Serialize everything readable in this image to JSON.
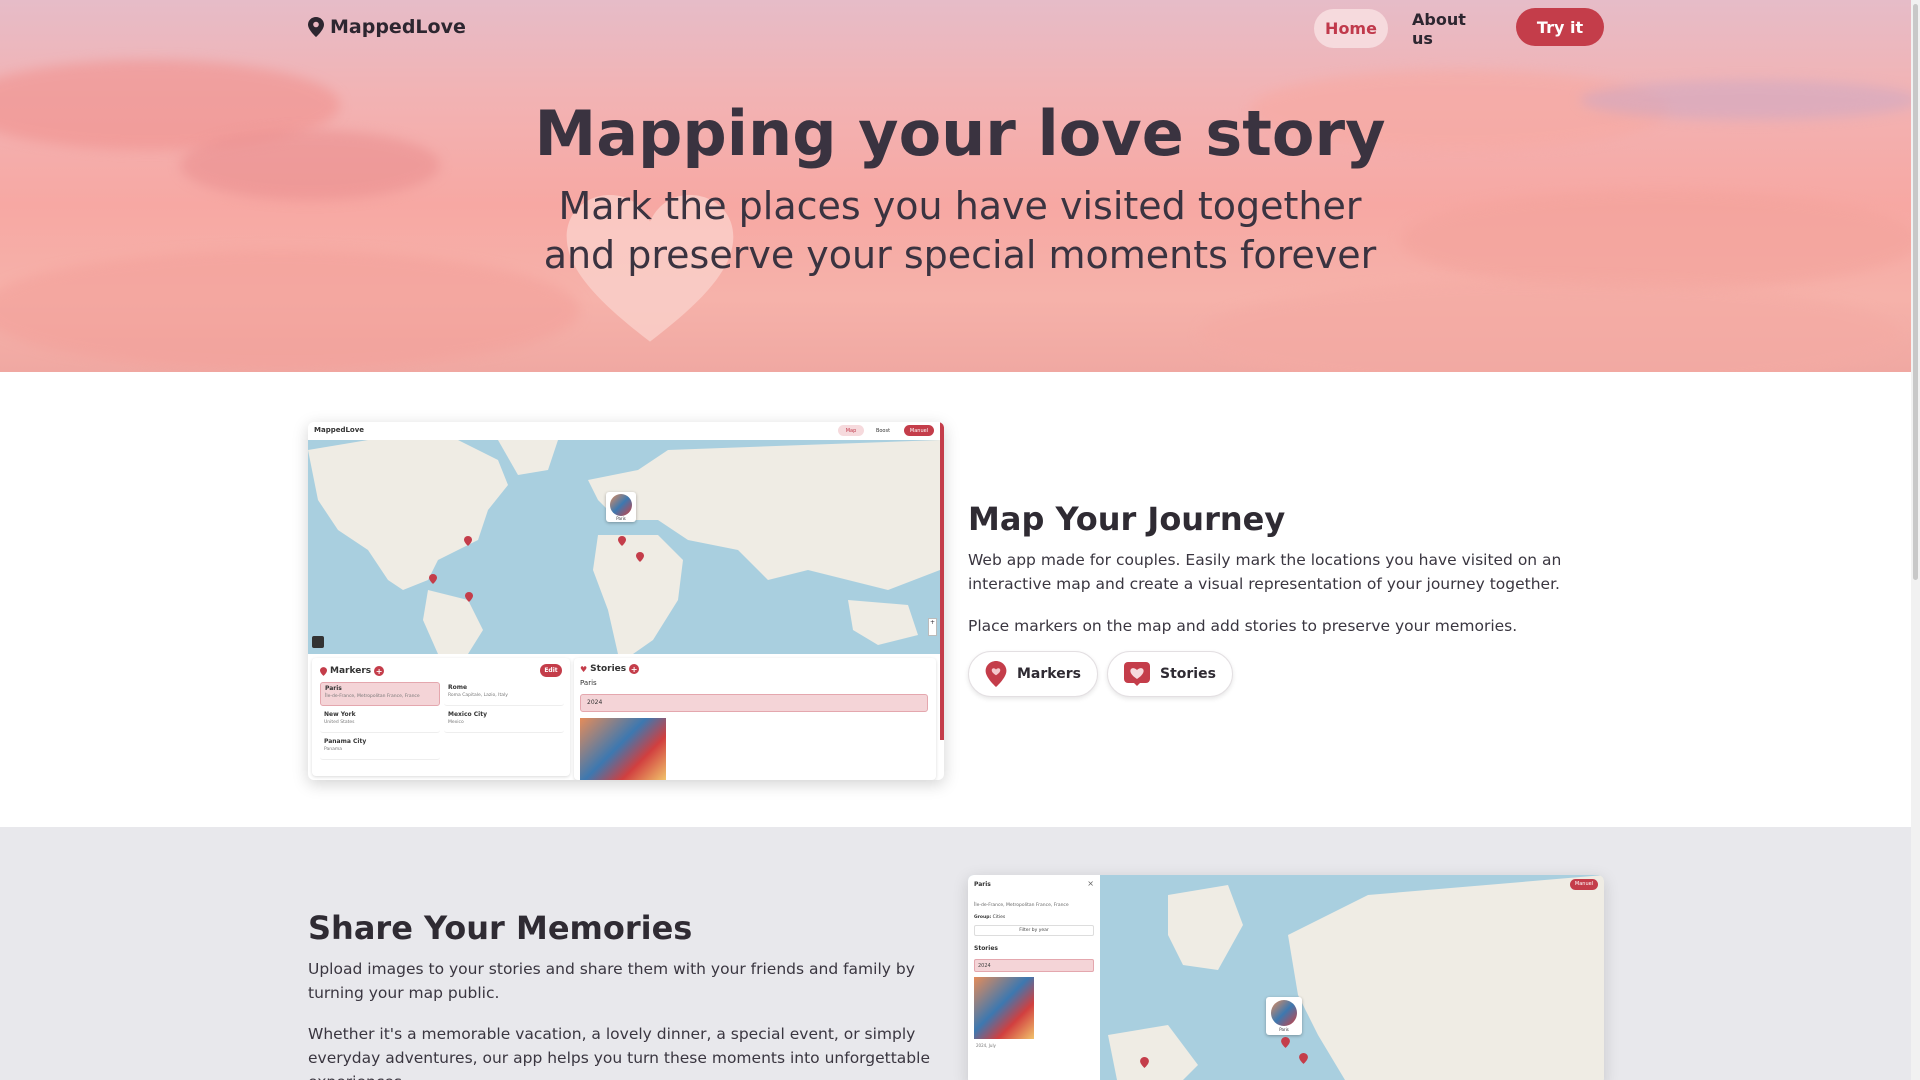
{
  "nav": {
    "brand": "MappedLove",
    "home": "Home",
    "about": "About us",
    "try": "Try it"
  },
  "hero": {
    "title": "Mapping your love story",
    "subtitle_line1": "Mark the places you have visited together",
    "subtitle_line2": "and preserve your special moments forever"
  },
  "journey": {
    "title": "Map Your Journey",
    "p1": "Web app made for couples. Easily mark the locations you have visited on an interactive map and create a visual representation of your journey together.",
    "p2": "Place markers on the map and add stories to preserve your memories.",
    "chip_markers": "Markers",
    "chip_stories": "Stories"
  },
  "mock1": {
    "brand": "MappedLove",
    "nav_map": "Map",
    "nav_boost": "Boost",
    "nav_user": "Manuel",
    "map_pin_label": "Paris",
    "markers_title": "Markers",
    "edit": "Edit",
    "markers": [
      {
        "name": "Paris",
        "sub": "Île-de-France, Metropolitan France, France"
      },
      {
        "name": "Rome",
        "sub": "Roma Capitale, Lazio, Italy"
      },
      {
        "name": "New York",
        "sub": "United States"
      },
      {
        "name": "Mexico City",
        "sub": "Mexico"
      },
      {
        "name": "Panama City",
        "sub": "Panama"
      }
    ],
    "stories_title": "Stories",
    "stories_place": "Paris",
    "year": "2024"
  },
  "memories": {
    "title": "Share Your Memories",
    "p1": "Upload images to your stories and share them with your friends and family by turning your map public.",
    "p2": "Whether it's a memorable vacation, a lovely dinner, a special event, or simply everyday adventures, our app helps you turn these moments into unforgettable experiences."
  },
  "mock2": {
    "place": "Paris",
    "region": "Île-de-France, Metropolitan France, France",
    "group_label": "Group:",
    "group_value": "Cities",
    "filter": "Filter by year",
    "stories": "Stories",
    "year": "2024",
    "caption": "2024, July",
    "user": "Manuel",
    "pin_label": "Paris"
  },
  "colors": {
    "accent": "#c43d4a",
    "accent_soft": "#f6dadd",
    "map_water": "#a9cfdf",
    "map_land": "#efece4",
    "section_gray": "#e8e8ec"
  }
}
